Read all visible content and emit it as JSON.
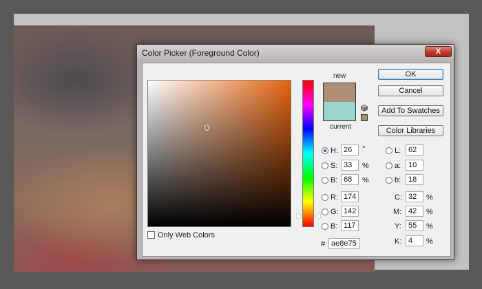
{
  "window": {
    "title": "Color Picker (Foreground Color)",
    "close_glyph": "X"
  },
  "preview": {
    "new_label": "new",
    "current_label": "current",
    "new_color": "#ae8e75",
    "current_color": "#9bd6cc",
    "websafe_color": "#999966",
    "field_hue_color": "#e5650e"
  },
  "buttons": {
    "ok": "OK",
    "cancel": "Cancel",
    "add_to_swatches": "Add To Swatches",
    "color_libraries": "Color Libraries"
  },
  "hsb": {
    "h": {
      "label": "H:",
      "value": "26",
      "unit": "°",
      "selected": true
    },
    "s": {
      "label": "S:",
      "value": "33",
      "unit": "%"
    },
    "b": {
      "label": "B:",
      "value": "68",
      "unit": "%"
    }
  },
  "rgb": {
    "r": {
      "label": "R:",
      "value": "174"
    },
    "g": {
      "label": "G:",
      "value": "142"
    },
    "b": {
      "label": "B:",
      "value": "117"
    }
  },
  "lab": {
    "l": {
      "label": "L:",
      "value": "62"
    },
    "a": {
      "label": "a:",
      "value": "10"
    },
    "b": {
      "label": "b:",
      "value": "18"
    }
  },
  "cmyk": {
    "c": {
      "label": "C:",
      "value": "32",
      "unit": "%"
    },
    "m": {
      "label": "M:",
      "value": "42",
      "unit": "%"
    },
    "y": {
      "label": "Y:",
      "value": "55",
      "unit": "%"
    },
    "k": {
      "label": "K:",
      "value": "4",
      "unit": "%"
    }
  },
  "hex": {
    "label": "#",
    "value": "ae8e75"
  },
  "only_web_colors": {
    "label": "Only Web Colors",
    "checked": false
  },
  "icons": {
    "cube": "gamut-cube-icon",
    "close": "close-icon"
  }
}
